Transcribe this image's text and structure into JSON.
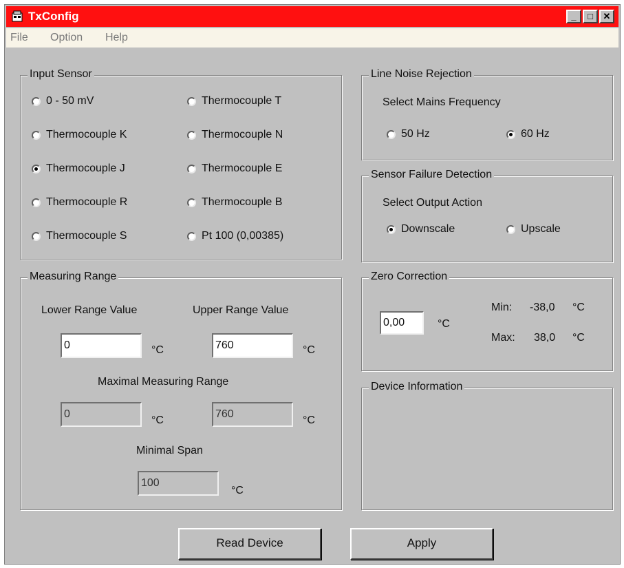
{
  "window": {
    "title": "TxConfig",
    "minimize_label": "_",
    "maximize_label": "□",
    "close_label": "✕"
  },
  "menu": [
    {
      "label": "File"
    },
    {
      "label": "Option"
    },
    {
      "label": "Help"
    }
  ],
  "input_sensor": {
    "title": "Input Sensor",
    "options": [
      {
        "label": "0 - 50 mV",
        "selected": false
      },
      {
        "label": "Thermocouple K",
        "selected": false
      },
      {
        "label": "Thermocouple J",
        "selected": true
      },
      {
        "label": "Thermocouple R",
        "selected": false
      },
      {
        "label": "Thermocouple S",
        "selected": false
      },
      {
        "label": "Thermocouple T",
        "selected": false
      },
      {
        "label": "Thermocouple N",
        "selected": false
      },
      {
        "label": "Thermocouple E",
        "selected": false
      },
      {
        "label": "Thermocouple B",
        "selected": false
      },
      {
        "label": "Pt 100 (0,00385)",
        "selected": false
      }
    ]
  },
  "measuring_range": {
    "title": "Measuring Range",
    "lower_label": "Lower Range Value",
    "upper_label": "Upper Range Value",
    "lower_value": "0",
    "upper_value": "760",
    "maximal_label": "Maximal Measuring Range",
    "max_lower": "0",
    "max_upper": "760",
    "minimal_span_label": "Minimal Span",
    "minimal_span": "100",
    "unit": "°C"
  },
  "line_noise": {
    "title": "Line Noise Rejection",
    "prompt": "Select Mains Frequency",
    "options": [
      {
        "label": "50 Hz",
        "selected": false
      },
      {
        "label": "60 Hz",
        "selected": true
      }
    ]
  },
  "sensor_failure": {
    "title": "Sensor Failure Detection",
    "prompt": "Select Output Action",
    "options": [
      {
        "label": "Downscale",
        "selected": true
      },
      {
        "label": "Upscale",
        "selected": false
      }
    ]
  },
  "zero_correction": {
    "title": "Zero Correction",
    "value": "0,00",
    "unit": "°C",
    "min_label": "Min:",
    "min_value": "-38,0",
    "max_label": "Max:",
    "max_value": "38,0"
  },
  "device_information": {
    "title": "Device Information"
  },
  "buttons": {
    "read_device": "Read Device",
    "apply": "Apply"
  },
  "colors": {
    "titlebar": "#ff1010",
    "face": "#c0c0c0",
    "menubar": "#f8f4e8"
  }
}
